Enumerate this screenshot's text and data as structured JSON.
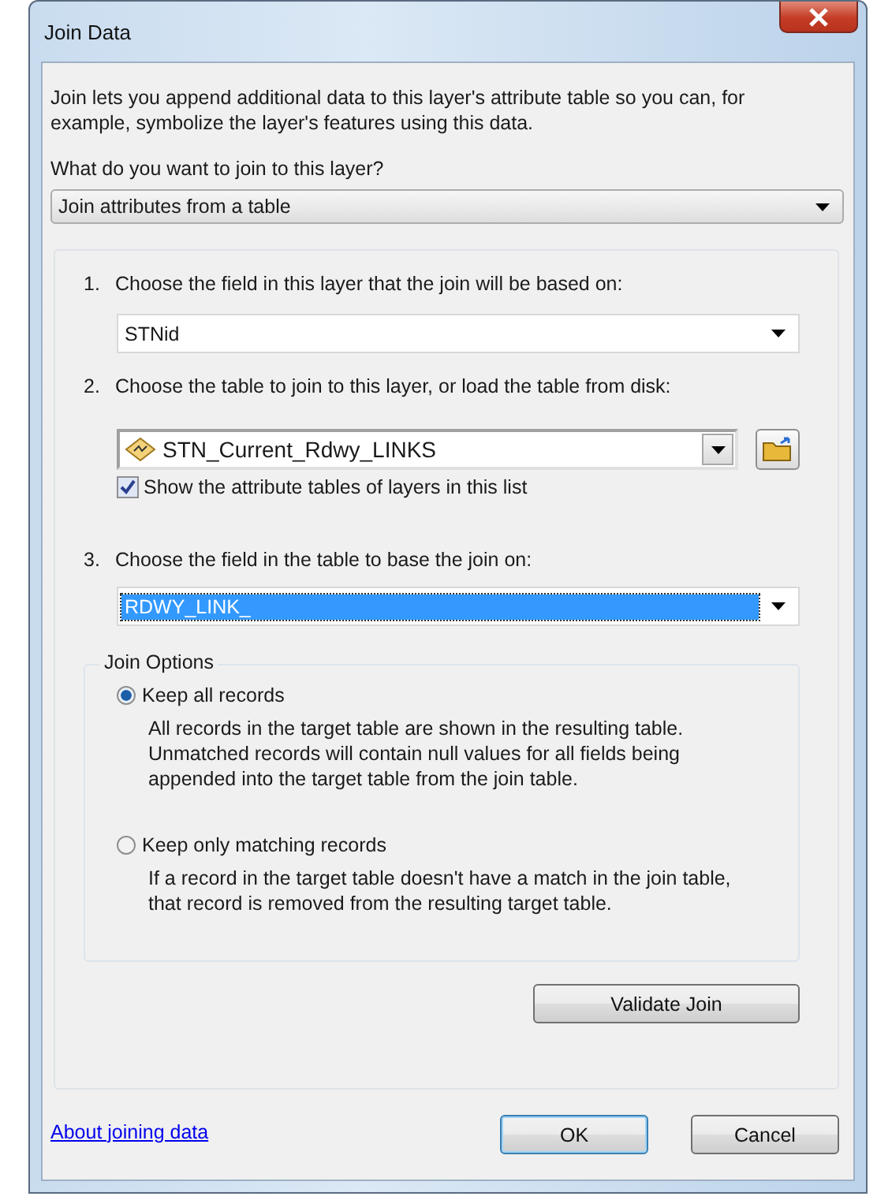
{
  "window": {
    "title": "Join Data"
  },
  "intro": "Join lets you append additional data to this layer's attribute table so you can, for example, symbolize the layer's features using this data.",
  "join_type": {
    "label": "What do you want to join to this layer?",
    "value": "Join attributes from a table"
  },
  "step_1": {
    "number": "1.",
    "label": "Choose the field in this layer that the join will be based on:",
    "value": "STNid"
  },
  "step_2": {
    "number": "2.",
    "label": "Choose the table to join to this layer, or load the table from disk:",
    "value": "STN_Current_Rdwy_LINKS",
    "show_layers": {
      "label": "Show the attribute tables of layers in this list",
      "checked": true
    }
  },
  "step_3": {
    "number": "3.",
    "label": "Choose the field in the table to base the join on:",
    "value": "RDWY_LINK_",
    "text_selected": true
  },
  "join_options": {
    "title": "Join Options",
    "options": [
      {
        "label": "Keep all records",
        "description": "All records in the target table are shown in the resulting table. Unmatched records will contain null values for all fields being appended into the target table from the join table.",
        "selected": true
      },
      {
        "label": "Keep only matching records",
        "description": "If a record in the target table doesn't have a match in the join table, that record is removed from the resulting target table.",
        "selected": false
      }
    ]
  },
  "validate_button": "Validate Join",
  "help_link": "About joining data",
  "buttons": [
    {
      "label": "OK",
      "default": true
    },
    {
      "label": "Cancel",
      "default": false
    }
  ]
}
